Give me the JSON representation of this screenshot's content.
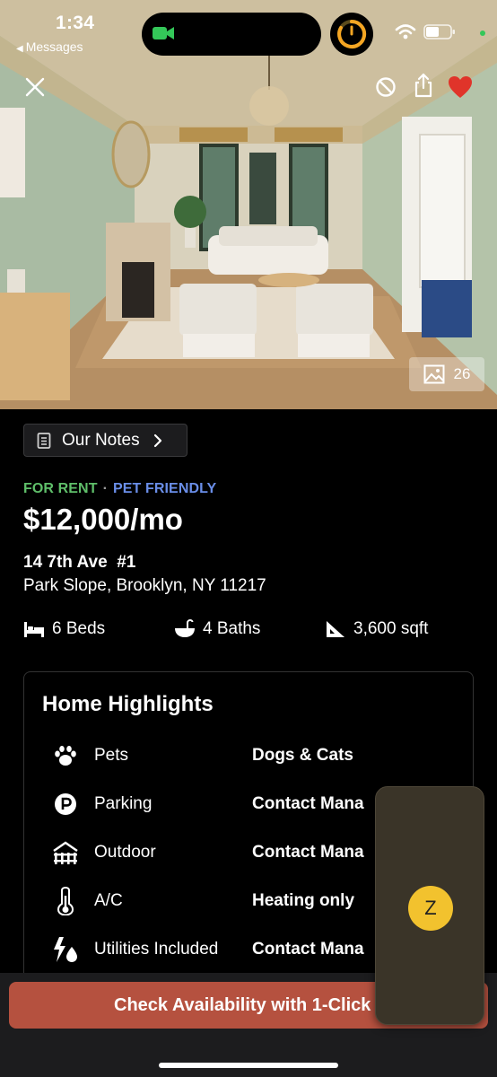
{
  "status_bar": {
    "time": "1:34",
    "back_app": "Messages"
  },
  "hero": {
    "photo_count": "26",
    "favorited": true,
    "icons": [
      "close-icon",
      "hide-icon",
      "share-icon",
      "heart-icon",
      "gallery-icon"
    ]
  },
  "notes": {
    "label": "Our Notes"
  },
  "listing": {
    "tag_rent": "FOR RENT",
    "tag_separator": "·",
    "tag_pet": "PET FRIENDLY",
    "price": "$12,000/mo",
    "address_line1": "14 7th Ave  #1",
    "address_line2": "Park Slope, Brooklyn, NY 11217"
  },
  "facts": {
    "beds": "6 Beds",
    "baths": "4 Baths",
    "sqft": "3,600 sqft"
  },
  "highlights": {
    "title": "Home Highlights",
    "rows": [
      {
        "label": "Pets",
        "value": "Dogs & Cats",
        "icon": "paw-icon"
      },
      {
        "label": "Parking",
        "value": "Contact Mana",
        "icon": "parking-icon"
      },
      {
        "label": "Outdoor",
        "value": "Contact Mana",
        "icon": "fence-icon"
      },
      {
        "label": "A/C",
        "value": "Heating only",
        "icon": "thermometer-icon"
      },
      {
        "label": "Utilities Included",
        "value": "Contact Mana",
        "icon": "utilities-icon"
      }
    ]
  },
  "cta": {
    "label": "Check Availability with 1-Click"
  },
  "pip": {
    "badge": "Z"
  },
  "colors": {
    "tag_rent": "#5fbf6a",
    "tag_pet": "#6a8ee8",
    "cta": "#b5513f",
    "heart": "#e0342a",
    "pip_badge": "#f2c22e"
  }
}
